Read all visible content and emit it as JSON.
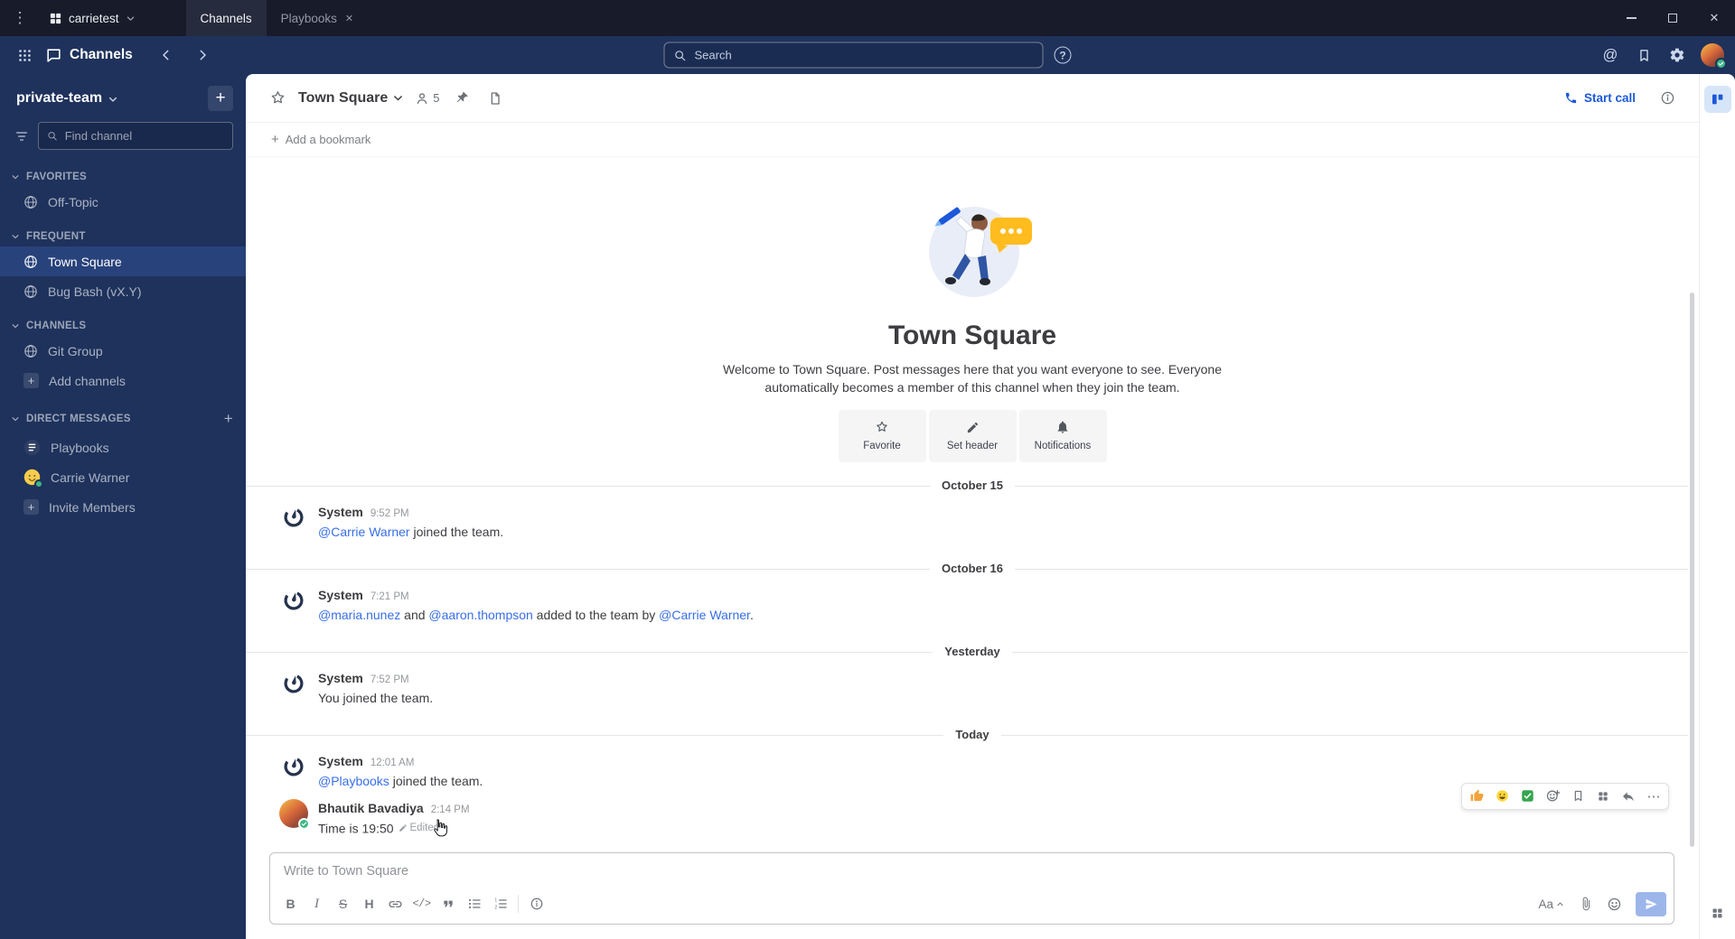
{
  "colors": {
    "topbar_bg": "#181b2a",
    "header_sidebar_bg": "#1e325c",
    "selected_channel_bg": "#28427b",
    "link_blue": "#386fe5",
    "call_button_blue": "#1c58d9",
    "online_green": "#3db887",
    "bubble_yellow": "#ffbc1f"
  },
  "icons": {
    "menu_dots": "⋮",
    "close": "✕",
    "plus": "+",
    "more": "⋯",
    "help": "?",
    "at": "@"
  },
  "window": {
    "server_name": "carrietest",
    "tabs": [
      {
        "label": "Channels"
      },
      {
        "label": "Playbooks"
      }
    ]
  },
  "global_header": {
    "product_name": "Channels",
    "search_placeholder": "Search"
  },
  "sidebar": {
    "team_name": "private-team",
    "find_channel_placeholder": "Find channel",
    "sections": [
      {
        "label": "FAVORITES",
        "items": [
          {
            "label": "Off-Topic"
          }
        ]
      },
      {
        "label": "FREQUENT",
        "items": [
          {
            "label": "Town Square"
          },
          {
            "label": "Bug Bash (vX.Y)"
          }
        ]
      },
      {
        "label": "CHANNELS",
        "items": [
          {
            "label": "Git Group"
          },
          {
            "label": "Add channels"
          }
        ]
      },
      {
        "label": "DIRECT MESSAGES",
        "items": [
          {
            "label": "Playbooks"
          },
          {
            "label": "Carrie Warner"
          },
          {
            "label": "Invite Members"
          }
        ]
      }
    ]
  },
  "channel_header": {
    "name": "Town Square",
    "member_count": "5",
    "start_call_label": "Start call"
  },
  "bookmarks": {
    "add_label": "Add a bookmark"
  },
  "intro": {
    "title": "Town Square",
    "description": "Welcome to Town Square. Post messages here that you want everyone to see. Everyone automatically becomes a member of this channel when they join the team.",
    "actions": [
      {
        "label": "Favorite"
      },
      {
        "label": "Set header"
      },
      {
        "label": "Notifications"
      }
    ]
  },
  "dividers": [
    "October 15",
    "October 16",
    "Yesterday",
    "Today"
  ],
  "messages": [
    {
      "user": "System",
      "time": "9:52 PM",
      "mention": "@Carrie Warner",
      "text": " joined the team."
    },
    {
      "user": "System",
      "time": "7:21 PM",
      "mention1": "@maria.nunez",
      "text1": " and ",
      "mention2": "@aaron.thompson",
      "text2": " added to the team by ",
      "mention3": "@Carrie Warner",
      "text3": "."
    },
    {
      "user": "System",
      "time": "7:52 PM",
      "text": "You joined the team."
    },
    {
      "user": "System",
      "time": "12:01 AM",
      "mention": "@Playbooks",
      "text": " joined the team."
    },
    {
      "user": "Bhautik Bavadiya",
      "time": "2:14 PM",
      "text": "Time is 19:50",
      "edited_label": "Edited"
    }
  ],
  "composer": {
    "placeholder": "Write to Town Square",
    "toolbar": {
      "bold": "B",
      "italic": "I",
      "strike": "S",
      "heading": "H",
      "code": "</>",
      "font_size": "Aa"
    }
  }
}
